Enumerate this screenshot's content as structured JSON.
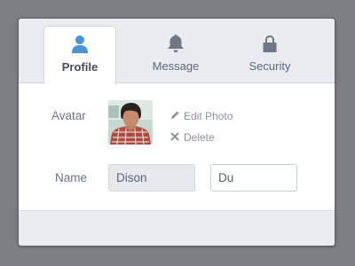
{
  "tabs": [
    {
      "label": "Profile",
      "icon": "user-icon",
      "active": true
    },
    {
      "label": "Message",
      "icon": "bell-icon",
      "active": false
    },
    {
      "label": "Security",
      "icon": "lock-icon",
      "active": false
    }
  ],
  "avatar_row": {
    "label": "Avatar",
    "edit_label": "Edit Photo",
    "delete_label": "Delete"
  },
  "name_row": {
    "label": "Name",
    "first_name": "Dison",
    "last_name": "Du"
  },
  "colors": {
    "accent": "#4a93d6",
    "tab_bar": "#e9edf1",
    "backdrop": "#7d7f84"
  }
}
